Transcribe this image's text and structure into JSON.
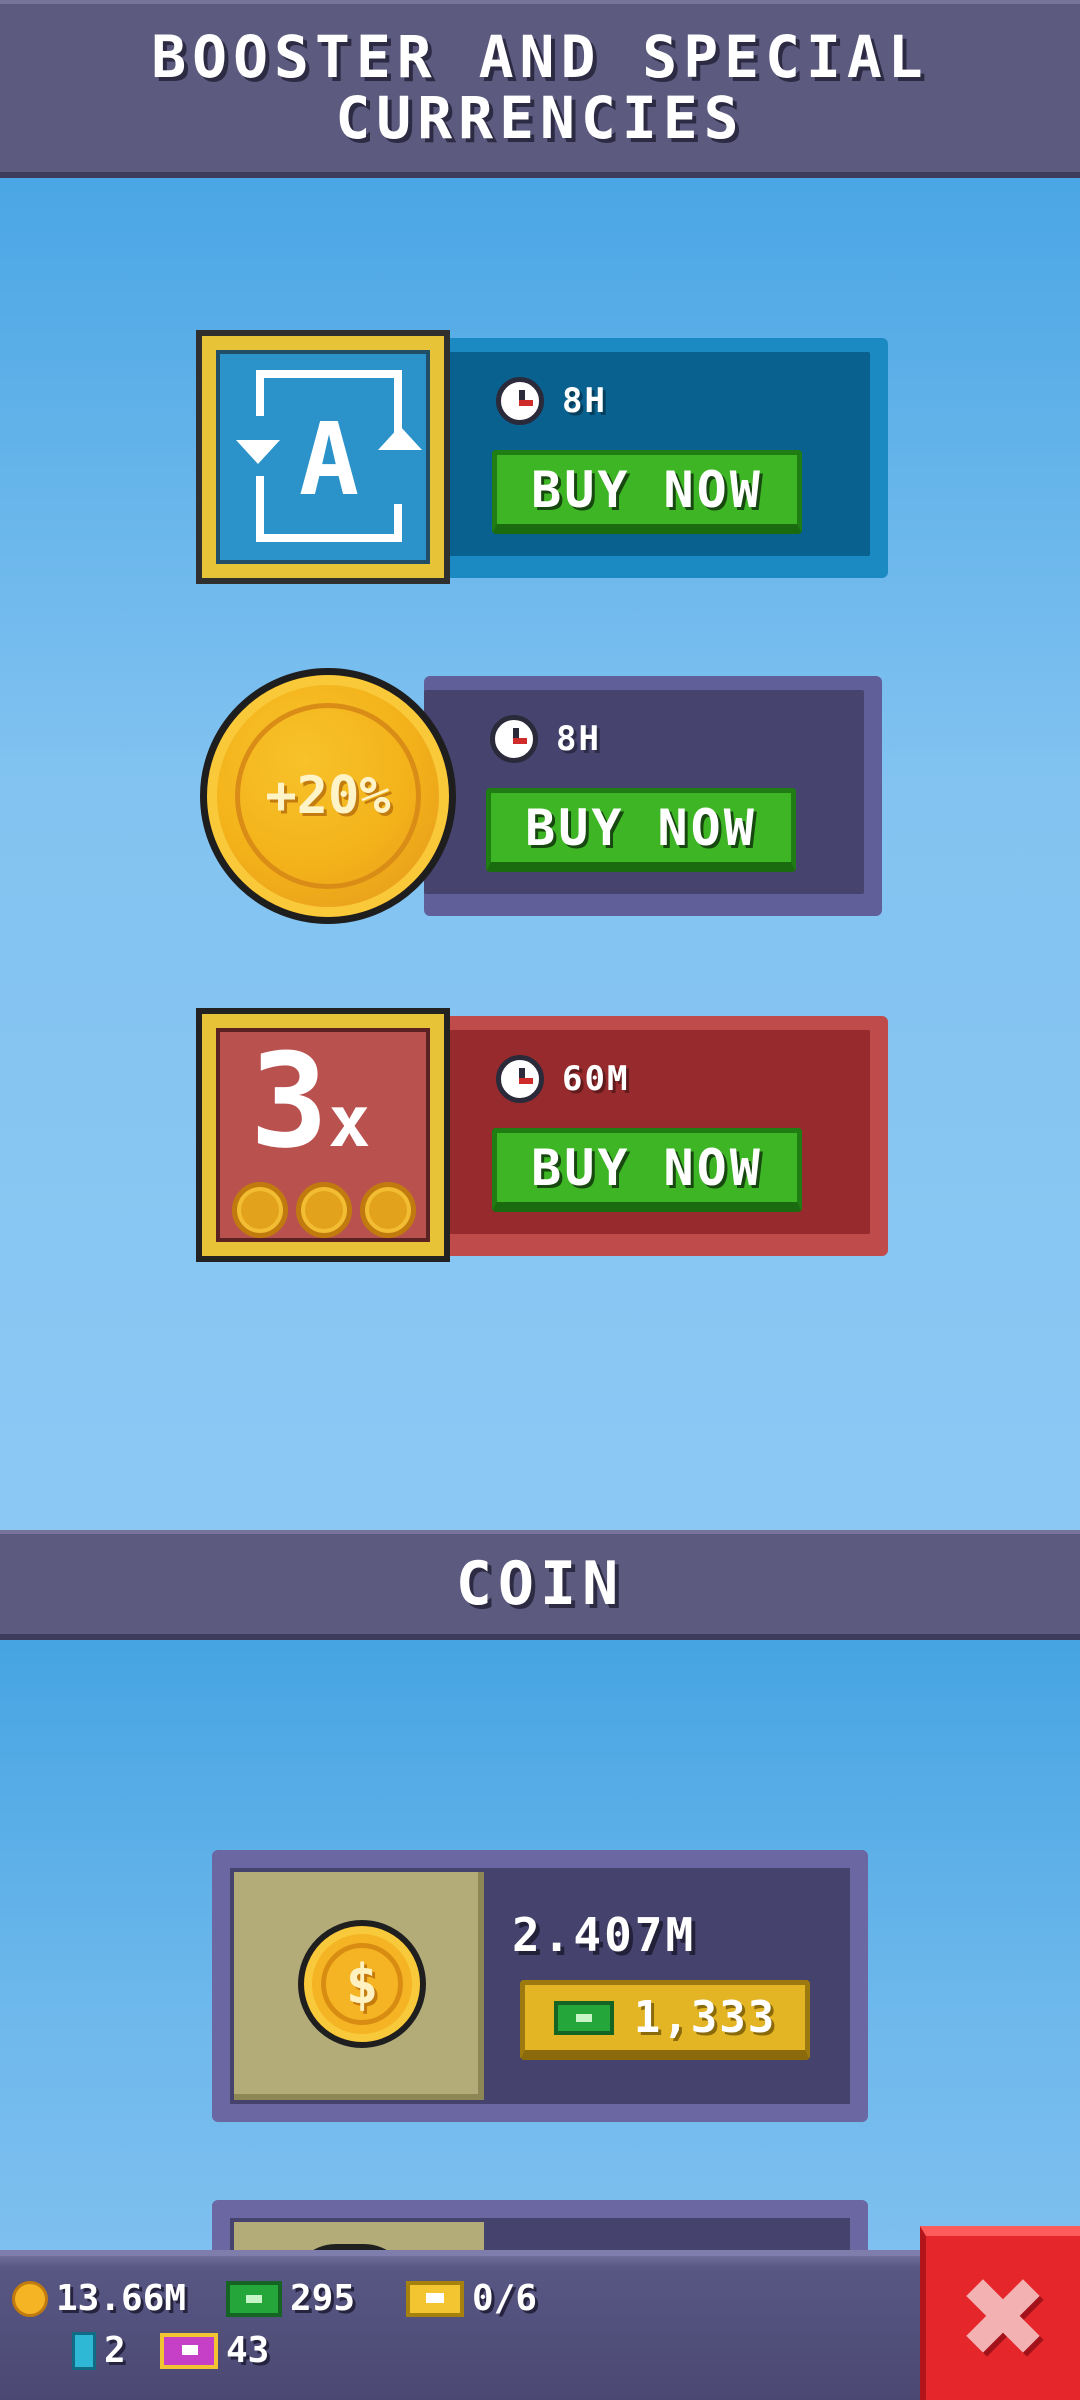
{
  "header": {
    "title": "BOOSTER AND SPECIAL CURRENCIES"
  },
  "boosters": [
    {
      "icon": "auto-collect-icon",
      "icon_text": "A",
      "duration": "8H",
      "button": "BUY NOW",
      "color": "#1b8ac2"
    },
    {
      "icon": "income-boost-coin-icon",
      "icon_text": "+20%",
      "duration": "8H",
      "button": "BUY NOW",
      "color": "#615f9a"
    },
    {
      "icon": "triple-coins-icon",
      "icon_text": "3",
      "icon_text_suffix": "x",
      "duration": "60M",
      "button": "BUY NOW",
      "color": "#c04b4b"
    }
  ],
  "coin_section": {
    "title": "COIN"
  },
  "coin_packs": [
    {
      "icon": "dollar-coin-icon",
      "icon_text": "$",
      "amount": "2.407M",
      "price_icon": "cash-icon",
      "price": "1,333"
    }
  ],
  "status_bar": {
    "coins": "13.66M",
    "cash": "295",
    "tickets": "0/6",
    "gems": "2",
    "passes": "43"
  },
  "close_button": {
    "icon": "close-icon",
    "glyph": "✖"
  },
  "colors": {
    "buy_button": "#3db525",
    "price_button": "#e3b423",
    "close": "#e5272b",
    "header": "#5c5a7e"
  }
}
